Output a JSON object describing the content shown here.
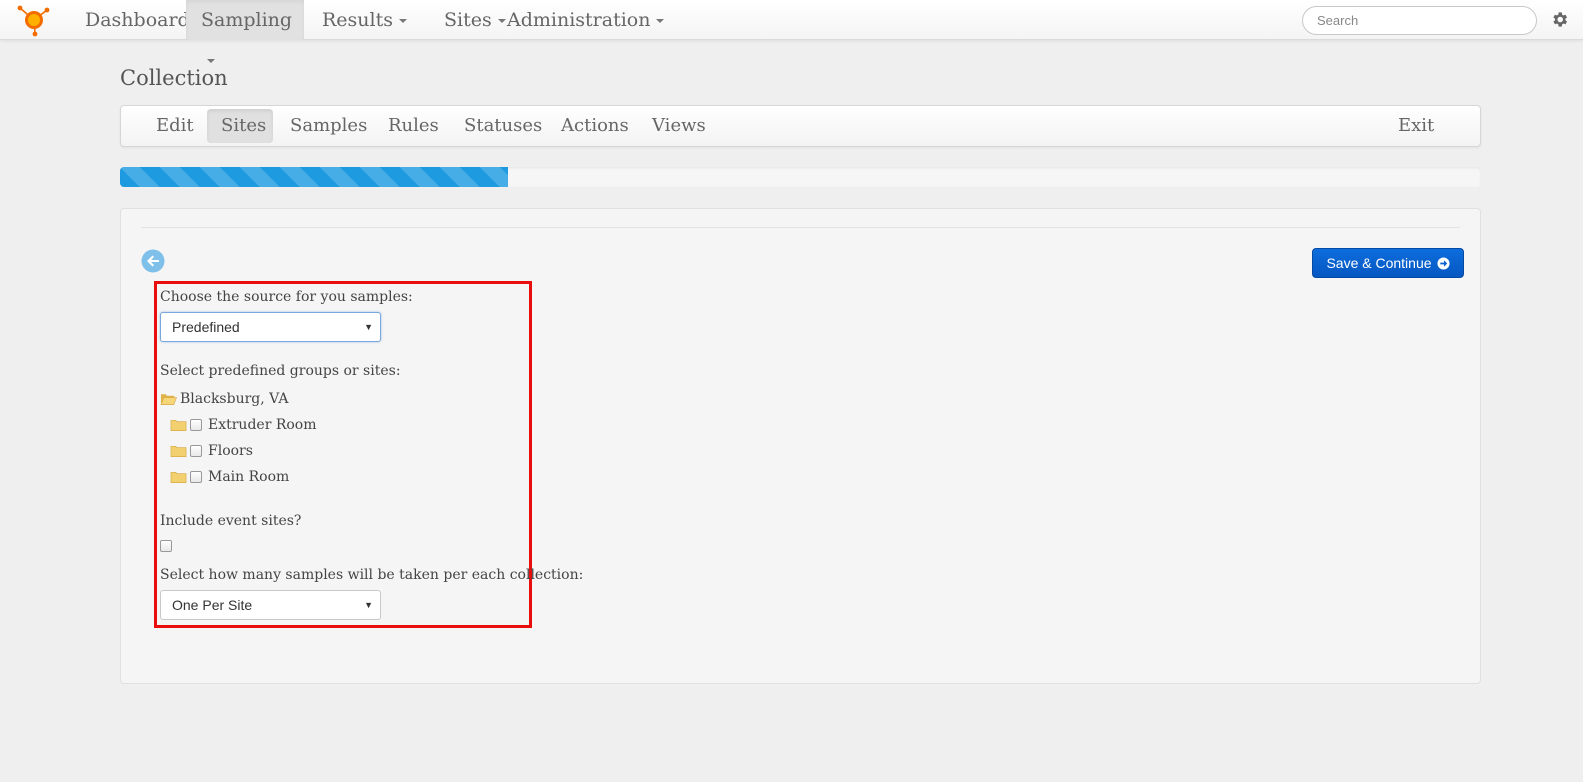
{
  "nav": {
    "items": [
      {
        "label": "Dashboard"
      },
      {
        "label": "Sampling"
      },
      {
        "label": "Results"
      },
      {
        "label": "Sites"
      },
      {
        "label": "Administration"
      }
    ],
    "search_placeholder": "Search"
  },
  "page": {
    "title": "Collection"
  },
  "tabs": [
    {
      "label": "Edit"
    },
    {
      "label": "Sites"
    },
    {
      "label": "Samples"
    },
    {
      "label": "Rules"
    },
    {
      "label": "Statuses"
    },
    {
      "label": "Actions"
    },
    {
      "label": "Views"
    }
  ],
  "exit_label": "Exit",
  "progress": {
    "percent": 28.5
  },
  "form": {
    "save_label": "Save & Continue",
    "source_label": "Choose the source for you samples:",
    "source_value": "Predefined",
    "groups_label": "Select predefined groups or sites:",
    "tree": {
      "root": "Blacksburg, VA",
      "children": [
        "Extruder Room",
        "Floors",
        "Main Room"
      ]
    },
    "event_label": "Include event sites?",
    "samples_label": "Select how many samples will be taken per each collection:",
    "samples_value": "One Per Site"
  },
  "colors": {
    "accent": "#1e9be0",
    "button": "#0d6ddc",
    "highlight": "#ea0d0d",
    "logo": "#f36c00"
  }
}
